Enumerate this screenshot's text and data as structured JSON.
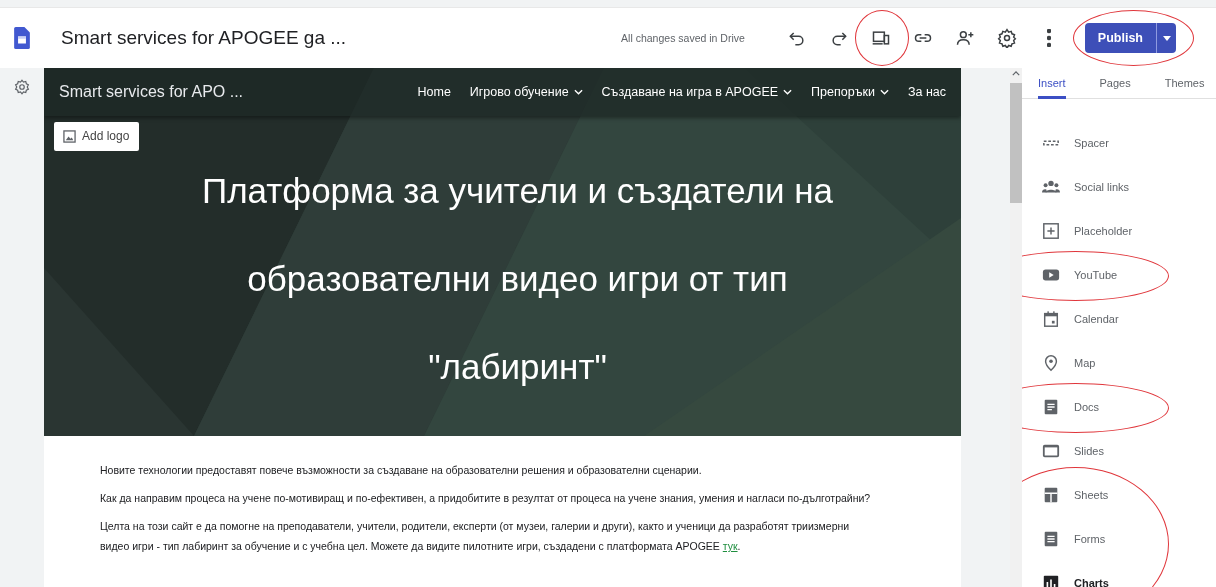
{
  "header": {
    "title": "Smart services for APOGEE ga ...",
    "save_status": "All changes saved in Drive",
    "toolbar": [
      {
        "kind": "undo",
        "circled": false
      },
      {
        "kind": "redo",
        "circled": false
      },
      {
        "kind": "preview",
        "circled": true
      },
      {
        "kind": "link",
        "circled": false
      },
      {
        "kind": "share",
        "circled": false
      },
      {
        "kind": "settings",
        "circled": false
      },
      {
        "kind": "more",
        "circled": false
      }
    ],
    "publish": {
      "label": "Publish",
      "circled": true
    }
  },
  "site": {
    "name": "Smart services for APO ...",
    "nav": [
      {
        "label": "Home",
        "dropdown": false
      },
      {
        "label": "Игрово обучение",
        "dropdown": true
      },
      {
        "label": "Създаване на игра в APOGEE",
        "dropdown": true
      },
      {
        "label": "Препоръки",
        "dropdown": true
      },
      {
        "label": "За нас",
        "dropdown": false
      }
    ],
    "add_logo": "Add logo",
    "hero_title": [
      "Платформа за учители и създатели на",
      "образователни видео игри от тип",
      "\"лабиринт\""
    ],
    "paragraphs": [
      "Новите технологии предоставят повече възможности за създаване на образователни решения и образователни сценарии.",
      "Как да направим процеса на учене по-мотивиращ и по-ефективен, а придобитите в резултат от процеса на учене знания, умения и нагласи по-дълготрайни?"
    ],
    "last_paragraph": {
      "text": "Целта на този сайт е да помогне на преподаватели, учители, родители, експерти (от музеи, галерии и други), както и ученици да разработят триизмерни видео игри - тип лабиринт за обучение и с учебна цел.  Можете да видите пилотните игри, създадени с платформата APOGEE",
      "link": "тук",
      "end": "."
    }
  },
  "panel": {
    "tabs": [
      {
        "label": "Insert",
        "selected": true
      },
      {
        "label": "Pages",
        "selected": false
      },
      {
        "label": "Themes",
        "selected": false
      }
    ],
    "items": [
      {
        "kind": "spacer",
        "label": "Spacer",
        "circled": false
      },
      {
        "kind": "social",
        "label": "Social links",
        "circled": false
      },
      {
        "kind": "placeholder",
        "label": "Placeholder",
        "circled": false
      },
      {
        "kind": "youtube",
        "label": "YouTube",
        "circled": true
      },
      {
        "kind": "calendar",
        "label": "Calendar",
        "circled": false
      },
      {
        "kind": "map",
        "label": "Map",
        "circled": false
      },
      {
        "kind": "docs",
        "label": "Docs",
        "circled": true
      },
      {
        "kind": "slides",
        "label": "Slides",
        "circled": false
      },
      {
        "kind": "sheets",
        "label": "Sheets",
        "circled": true
      },
      {
        "kind": "forms",
        "label": "Forms",
        "circled": true
      },
      {
        "kind": "charts",
        "label": "Charts",
        "circled": true
      }
    ]
  }
}
